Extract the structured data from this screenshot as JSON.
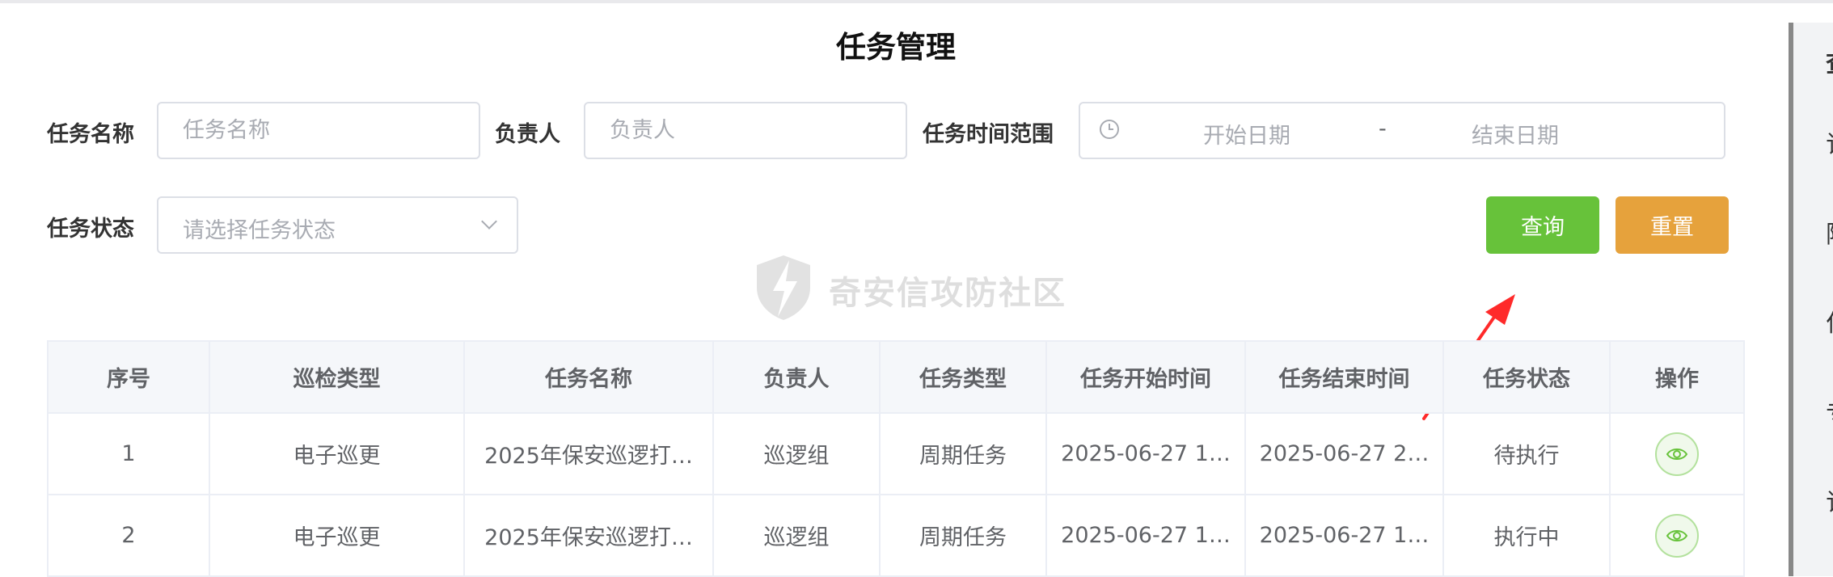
{
  "page": {
    "title": "任务管理"
  },
  "search": {
    "task_name_label": "任务名称",
    "task_name_placeholder": "任务名称",
    "owner_label": "负责人",
    "owner_placeholder": "负责人",
    "time_range_label": "任务时间范围",
    "start_placeholder": "开始日期",
    "range_separator": "-",
    "end_placeholder": "结束日期",
    "status_label": "任务状态",
    "status_placeholder": "请选择任务状态",
    "query_label": "查询",
    "reset_label": "重置"
  },
  "watermark": {
    "text": "奇安信攻防社区"
  },
  "table": {
    "headers": [
      "序号",
      "巡检类型",
      "任务名称",
      "负责人",
      "任务类型",
      "任务开始时间",
      "任务结束时间",
      "任务状态",
      "操作"
    ],
    "rows": [
      {
        "index": "1",
        "inspection_type": "电子巡更",
        "name": "2025年保安巡逻打…",
        "owner": "巡逻组",
        "task_type": "周期任务",
        "start": "2025-06-27 1…",
        "end": "2025-06-27 2…",
        "status": "待执行",
        "action_icon": "eye-icon"
      },
      {
        "index": "2",
        "inspection_type": "电子巡更",
        "name": "2025年保安巡逻打…",
        "owner": "巡逻组",
        "task_type": "周期任务",
        "start": "2025-06-27 1…",
        "end": "2025-06-27 1…",
        "status": "执行中",
        "action_icon": "eye-icon"
      }
    ]
  },
  "side_panel": {
    "chars": [
      "查",
      "订",
      "附",
      "付",
      "专",
      "订"
    ]
  },
  "colors": {
    "query": "#67c23a",
    "reset": "#e6a23c",
    "arrow": "#ff2a2a",
    "border": "#dcdfe6"
  }
}
